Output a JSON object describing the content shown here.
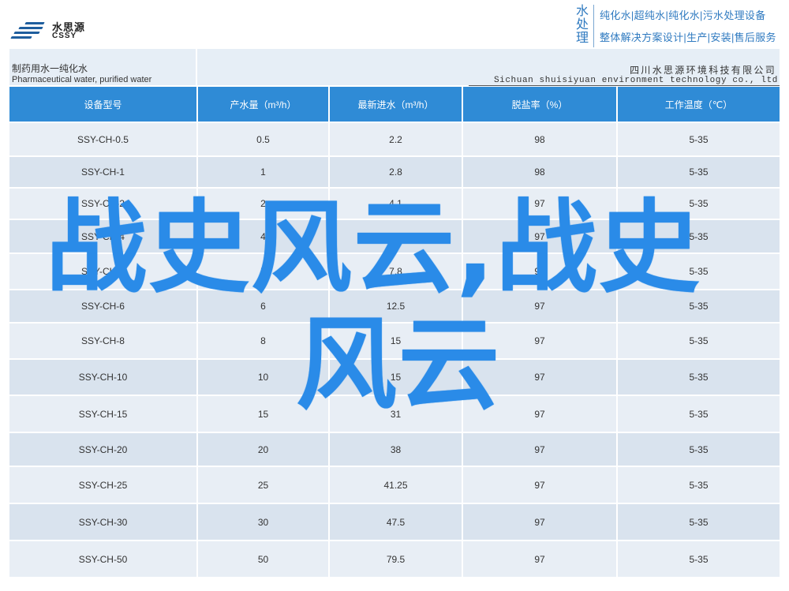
{
  "header": {
    "logo_cn": "水思源",
    "logo_en": "CSSY",
    "brand_vertical": "水处理",
    "tagline_1": "纯化水|超纯水|纯化水|污水处理设备",
    "tagline_2": "整体解决方案设计|生产|安装|售后服务"
  },
  "band": {
    "title_cn": "制药用水一纯化水",
    "title_en": "Pharmaceutical water, purified water",
    "company_cn": "四川水思源环境科技有限公司",
    "company_en": "Sichuan shuisiyuan environment technology co., ltd"
  },
  "table": {
    "headers": [
      "设备型号",
      "产水量（m³/h）",
      "最新进水（m³/h）",
      "脱盐率（%）",
      "工作温度（℃）"
    ],
    "rows": [
      [
        "SSY-CH-0.5",
        "0.5",
        "2.2",
        "98",
        "5-35"
      ],
      [
        "SSY-CH-1",
        "1",
        "2.8",
        "98",
        "5-35"
      ],
      [
        "SSY-CH-2",
        "2",
        "4.1",
        "97",
        "5-35"
      ],
      [
        "SSY-CH-4",
        "4",
        "6.5",
        "97",
        "5-35"
      ],
      [
        "SSY-CH-5",
        "5",
        "7.8",
        "97",
        "5-35"
      ],
      [
        "SSY-CH-6",
        "6",
        "12.5",
        "97",
        "5-35"
      ],
      [
        "SSY-CH-8",
        "8",
        "15",
        "97",
        "5-35"
      ],
      [
        "SSY-CH-10",
        "10",
        "15",
        "97",
        "5-35"
      ],
      [
        "SSY-CH-15",
        "15",
        "31",
        "97",
        "5-35"
      ],
      [
        "SSY-CH-20",
        "20",
        "38",
        "97",
        "5-35"
      ],
      [
        "SSY-CH-25",
        "25",
        "41.25",
        "97",
        "5-35"
      ],
      [
        "SSY-CH-30",
        "30",
        "47.5",
        "97",
        "5-35"
      ],
      [
        "SSY-CH-50",
        "50",
        "79.5",
        "97",
        "5-35"
      ]
    ],
    "row_heights": [
      43,
      40,
      40,
      43,
      46,
      42,
      46,
      46,
      47,
      43,
      47,
      47,
      47
    ]
  },
  "overlay": {
    "line_1": "战史风云,战史",
    "line_2": "风云"
  },
  "colors": {
    "header_blue": "#2f8bd6",
    "row_light": "#e8eef5",
    "row_dark": "#d9e3ee",
    "overlay_blue": "#2a8be8",
    "brand_blue": "#2f7ac0"
  }
}
